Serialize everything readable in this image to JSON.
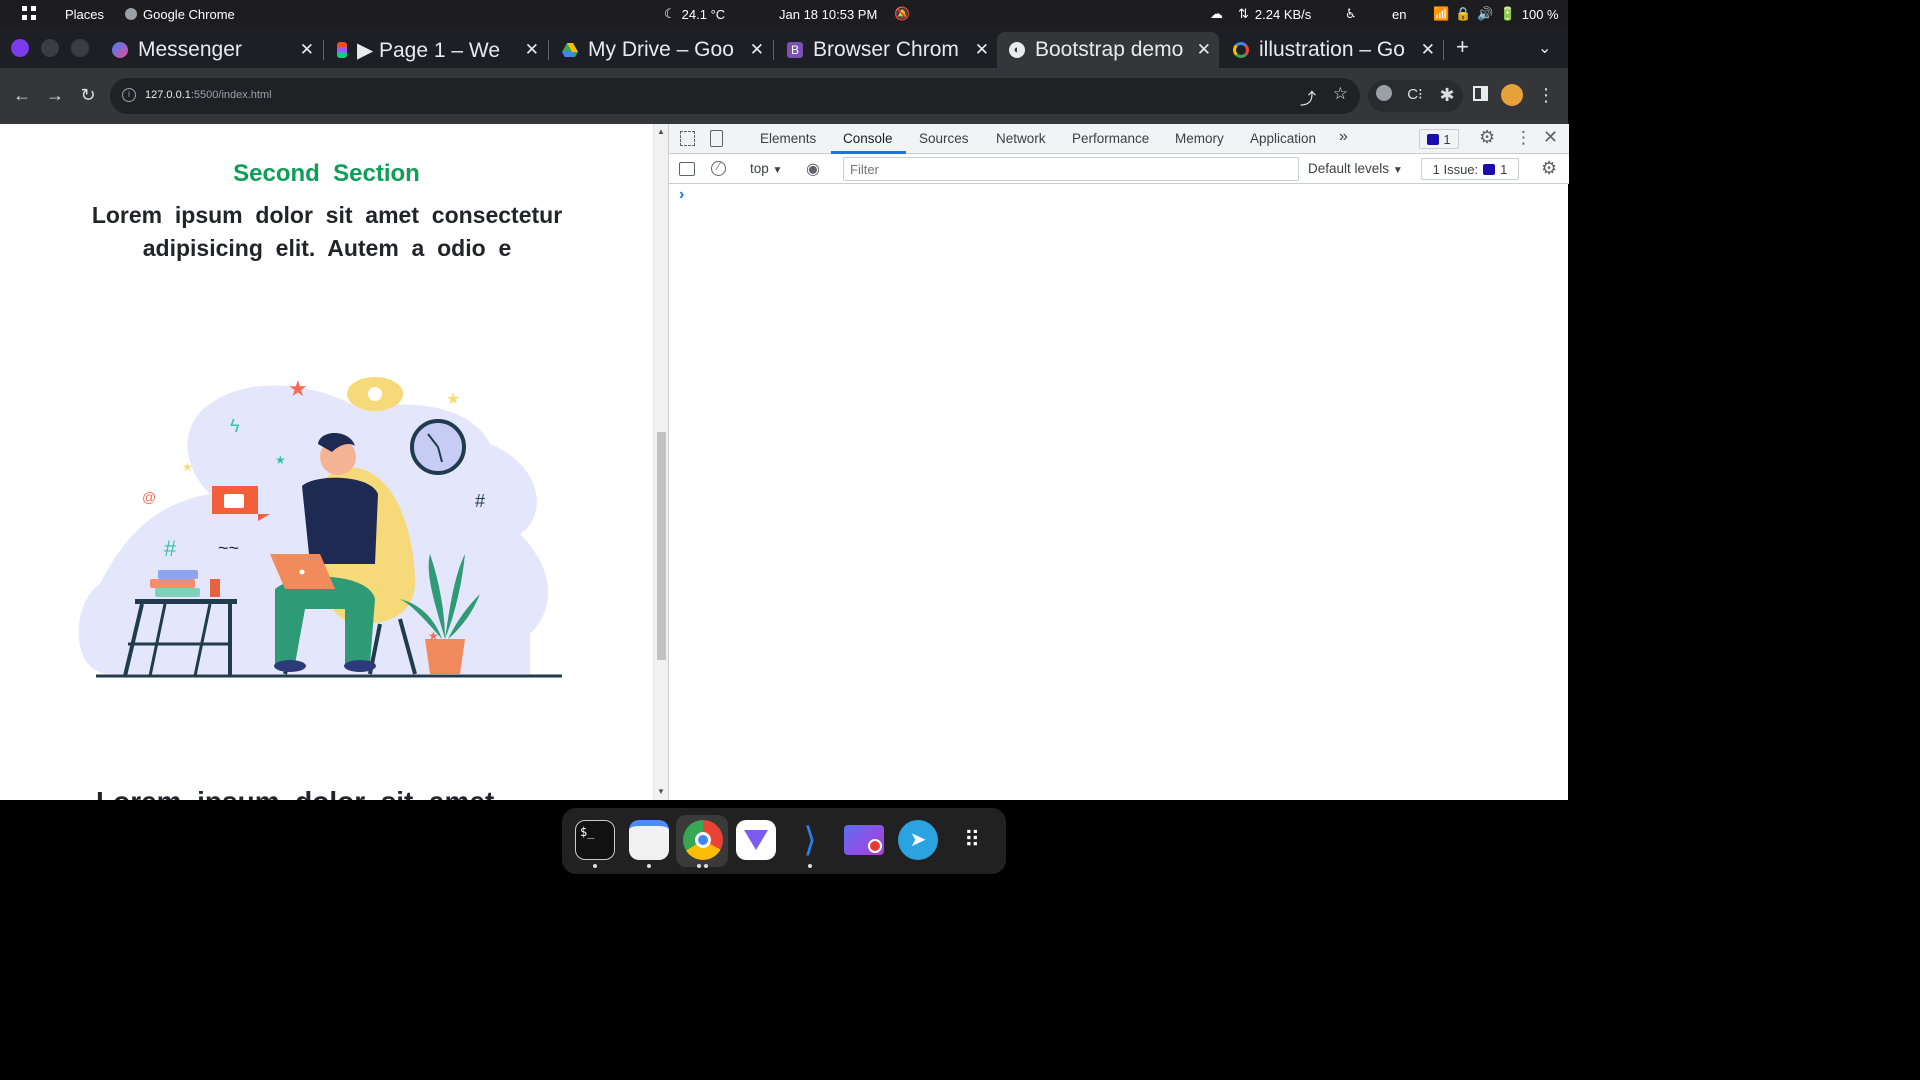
{
  "topbar": {
    "places": "Places",
    "app": "Google Chrome",
    "weather": "24.1 °C",
    "datetime": "Jan 18  10:53 PM",
    "net": "2.24 KB/s",
    "lang": "en",
    "battery": "100 %"
  },
  "tabs": [
    {
      "title": "Messenger"
    },
    {
      "title": "▶ Page 1 – We"
    },
    {
      "title": "My Drive – Goo"
    },
    {
      "title": "Browser Chrom"
    },
    {
      "title": "Bootstrap demo"
    },
    {
      "title": "illustration – Go"
    }
  ],
  "url": {
    "host": "127.0.0.1",
    "path": ":5500/index.html"
  },
  "page": {
    "section_title": "Second  Section",
    "paragraph": "Lorem  ipsum  dolor  sit  amet  consectetur adipisicing  elit.  Autem  a  odio  e",
    "next_heading": "Lorem  ipsum  dolor  sit  amet"
  },
  "devtools": {
    "tabs": [
      "Elements",
      "Console",
      "Sources",
      "Network",
      "Performance",
      "Memory",
      "Application"
    ],
    "more": "»",
    "issues_badge": "1",
    "context": "top",
    "filter_placeholder": "Filter",
    "levels": "Default levels",
    "issues_label": "1 Issue:",
    "issues_count": "1",
    "prompt": "›"
  },
  "colors": {
    "accent": "#1a73e8",
    "section_title": "#0f9d58",
    "devtools_prompt": "#1a73e8"
  }
}
